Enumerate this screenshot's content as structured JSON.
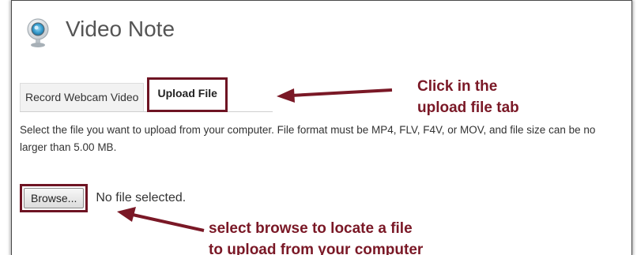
{
  "header": {
    "title": "Video Note",
    "icon": "webcam-icon"
  },
  "tabs": [
    {
      "label": "Record Webcam Video",
      "active": false
    },
    {
      "label": "Upload File",
      "active": true
    }
  ],
  "instructions": {
    "text": "Select the file you want to upload from your computer. File format must be MP4, FLV, F4V, or MOV, and file size can be no larger than 5.00 MB."
  },
  "file_input": {
    "browse_label": "Browse...",
    "status": "No file selected."
  },
  "annotations": {
    "tab_line1": "Click in the",
    "tab_line2": "upload file tab",
    "browse_line1": "select browse to locate a file",
    "browse_line2": "to upload from your computer"
  },
  "colors": {
    "annotation": "#7a1826",
    "highlight_border": "#6e1423",
    "title_text": "#555555"
  }
}
